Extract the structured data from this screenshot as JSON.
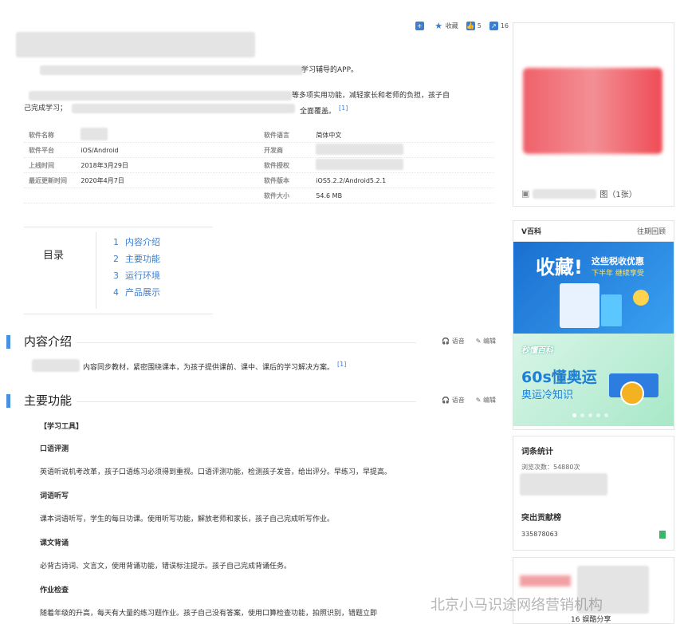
{
  "toolbar": {
    "collect": "收藏",
    "like_count": "5",
    "share_count": "16"
  },
  "intro": {
    "line1_tail": "学习辅导的APP。",
    "line2_tail": "等多项实用功能，减轻家长和老师的负担，孩子自",
    "line3_head": "己完成学习；",
    "line3_tail": "全面覆盖。",
    "ref": "[1]"
  },
  "info": {
    "rows": [
      {
        "k1": "软件名称",
        "v1": "",
        "k2": "软件语言",
        "v2": "简体中文"
      },
      {
        "k1": "软件平台",
        "v1": "iOS/Android",
        "k2": "开发商",
        "v2": ""
      },
      {
        "k1": "上线时间",
        "v1": "2018年3月29日",
        "k2": "软件授权",
        "v2": ""
      },
      {
        "k1": "最近更新时间",
        "v1": "2020年4月7日",
        "k2": "软件版本",
        "v2": "iOS5.2.2/Android5.2.1"
      },
      {
        "k1": "",
        "v1": "",
        "k2": "软件大小",
        "v2": "54.6 MB"
      }
    ]
  },
  "toc": {
    "label": "目录",
    "items": [
      {
        "n": "1",
        "t": "内容介绍"
      },
      {
        "n": "2",
        "t": "主要功能"
      },
      {
        "n": "3",
        "t": "运行环境"
      },
      {
        "n": "4",
        "t": "产品展示"
      }
    ]
  },
  "section1": {
    "title": "内容介绍",
    "voice": "语音",
    "edit": "编辑",
    "text": "内容同步教材，紧密围绕课本，为孩子提供课前、课中、课后的学习解决方案。",
    "ref": "[1]"
  },
  "section2": {
    "title": "主要功能",
    "voice": "语音",
    "edit": "编辑",
    "tools_header": "【学习工具】",
    "items": [
      {
        "h": "口语评测",
        "p": "英语听说机考改革，孩子口语练习必须得到重视。口语评测功能，检测孩子发音，给出评分。早练习，早提高。"
      },
      {
        "h": "词语听写",
        "p": "课本词语听写，学生的每日功课。使用听写功能，解放老师和家长，孩子自己完成听写作业。"
      },
      {
        "h": "课文背诵",
        "p": "必背古诗词、文言文，使用背诵功能，错误标注提示。孩子自己完成背诵任务。"
      },
      {
        "h": "作业检查",
        "p": "随着年级的升高，每天有大量的练习题作业。孩子自己没有答案，使用口算检查功能，拍照识别，错题立即"
      }
    ]
  },
  "sidebar": {
    "album_text": "图（1张）",
    "vbaike_title": "V百科",
    "vbaike_more": "往期回顾",
    "banner1_big": "收藏!",
    "banner1_small": "这些税收优惠",
    "banner1_sub": "下半年 继续享受",
    "banner2_logo": "秒懂百科",
    "banner2_line1": "60s懂奥运",
    "banner2_line2": "奥运冷知识",
    "stats_title": "词条统计",
    "stats_views": "浏览次数：54880次",
    "contrib_title": "突出贡献榜",
    "contrib_user": "335878063",
    "rank_bottom": "16  娱酷分享"
  },
  "watermark": "北京小马识途网络营销机构"
}
